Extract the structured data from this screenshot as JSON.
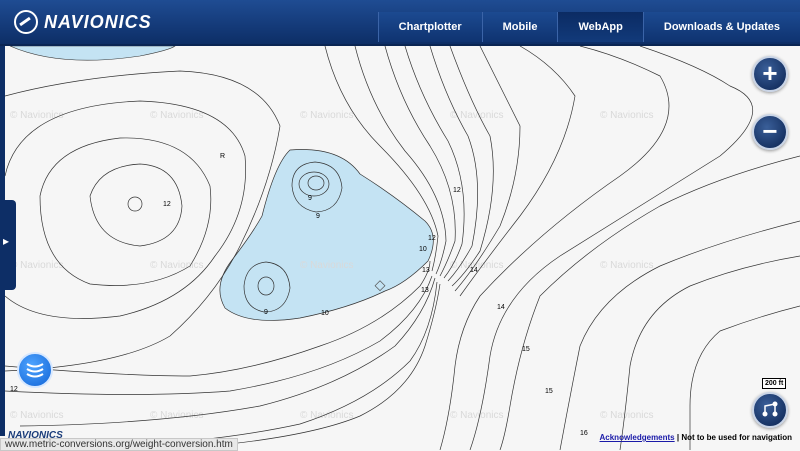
{
  "header": {
    "logo_text": "NAVIONICS",
    "nav": [
      {
        "label": "Chartplotter",
        "active": false
      },
      {
        "label": "Mobile",
        "active": false
      },
      {
        "label": "WebApp",
        "active": true
      },
      {
        "label": "Downloads & Updates",
        "active": false
      }
    ]
  },
  "map": {
    "watermark": "© Navionics",
    "depth_labels": [
      "12",
      "12",
      "12",
      "10",
      "13",
      "14",
      "14",
      "15",
      "15",
      "16",
      "13",
      "9",
      "9",
      "9",
      "R",
      "12",
      "10"
    ],
    "scale_label": "200 ft",
    "zoom_in_label": "+",
    "zoom_out_label": "−",
    "marker": "R"
  },
  "footer": {
    "bottom_logo": "NAVIONICS",
    "status_url": "www.metric-conversions.org/weight-conversion.htm",
    "ack_link": "Acknowledgements",
    "ack_text": " | Not to be used for navigation"
  },
  "colors": {
    "header": "#0d2e66",
    "water_shallow": "#c4e3f3",
    "contour": "#333333"
  }
}
